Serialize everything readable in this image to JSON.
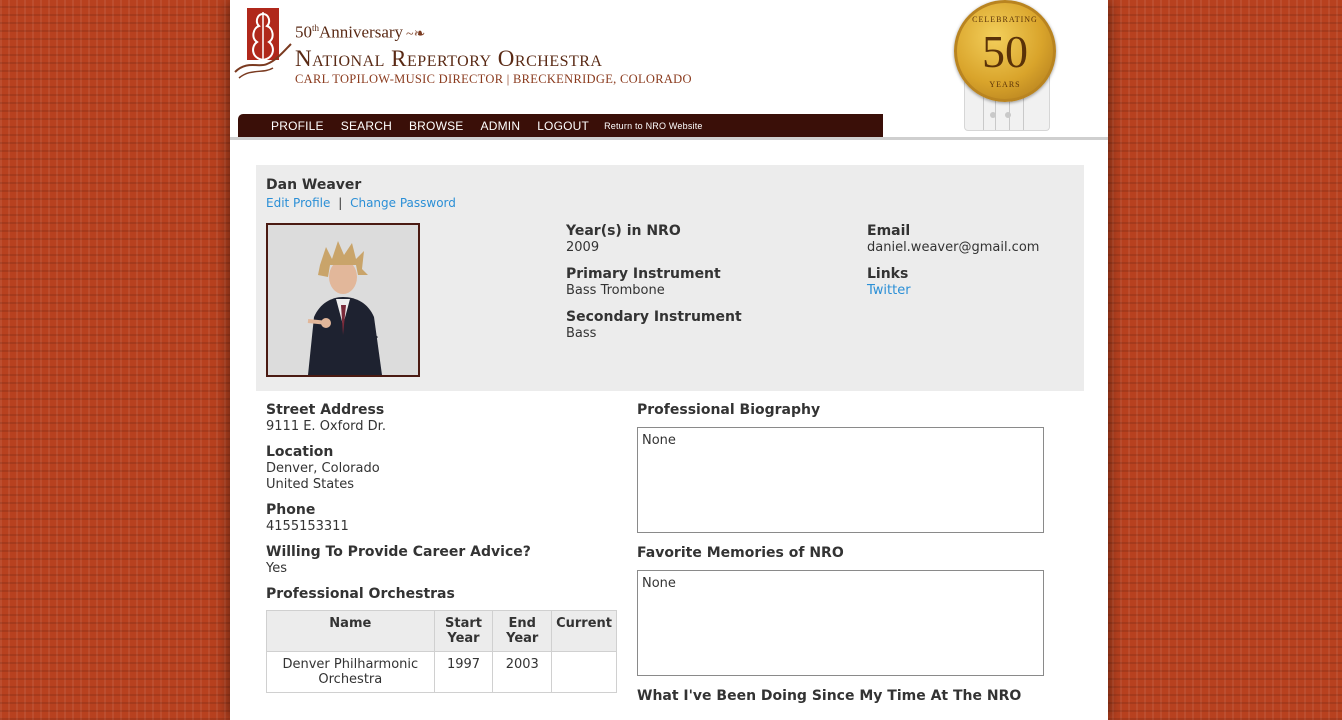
{
  "header": {
    "anniversary": "50",
    "anniversary_suffix": "th",
    "anniversary_word": "Anniversary",
    "org_name": "National Repertory Orchestra",
    "subtitle": "CARL TOPILOW-MUSIC DIRECTOR | BRECKENRIDGE, COLORADO",
    "seal": {
      "top": "CELEBRATING",
      "number": "50",
      "bottom": "YEARS"
    }
  },
  "nav": {
    "items": [
      "PROFILE",
      "SEARCH",
      "BROWSE",
      "ADMIN",
      "LOGOUT"
    ],
    "return_link": "Return to NRO Website"
  },
  "profile": {
    "name": "Dan Weaver",
    "edit_profile": "Edit Profile",
    "separator": "|",
    "change_password": "Change Password",
    "years_label": "Year(s) in NRO",
    "years_value": "2009",
    "primary_label": "Primary Instrument",
    "primary_value": "Bass Trombone",
    "secondary_label": "Secondary Instrument",
    "secondary_value": "Bass",
    "email_label": "Email",
    "email_value": "daniel.weaver@gmail.com",
    "links_label": "Links",
    "links_value": "Twitter"
  },
  "details": {
    "street_label": "Street Address",
    "street_value": "9111 E. Oxford Dr.",
    "location_label": "Location",
    "location_line1": "Denver, Colorado",
    "location_line2": "United States",
    "phone_label": "Phone",
    "phone_value": "4155153311",
    "advice_label": "Willing To Provide Career Advice?",
    "advice_value": "Yes",
    "orchestras_label": "Professional Orchestras",
    "table": {
      "headers": [
        "Name",
        "Start Year",
        "End Year",
        "Current"
      ],
      "rows": [
        [
          "Denver Philharmonic Orchestra",
          "1997",
          "2003",
          ""
        ]
      ]
    }
  },
  "bio": {
    "bio_label": "Professional Biography",
    "bio_value": "None",
    "memories_label": "Favorite Memories of NRO",
    "memories_value": "None",
    "since_label": "What I've Been Doing Since My Time At The NRO"
  },
  "colors": {
    "background": "#b8411f",
    "nav": "#3a0f08",
    "link": "#2b8fd6",
    "panel": "#ececec"
  }
}
